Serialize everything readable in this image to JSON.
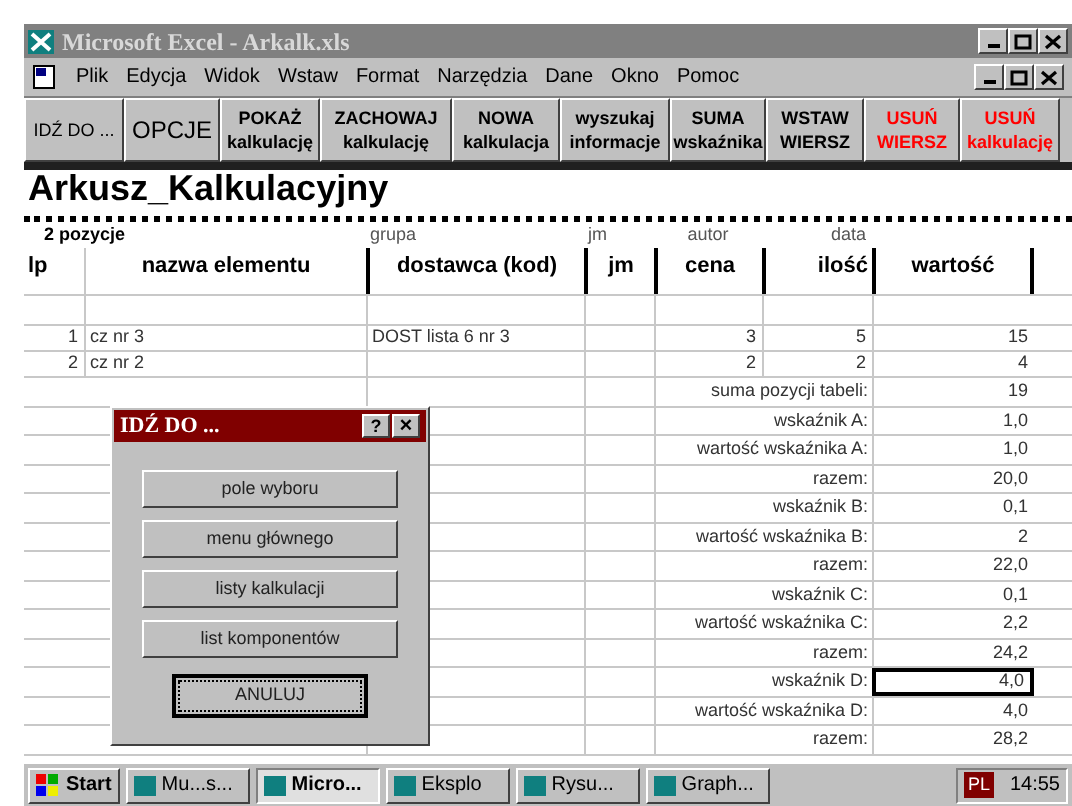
{
  "window": {
    "title": "Microsoft Excel - Arkalk.xls"
  },
  "menu": [
    "Plik",
    "Edycja",
    "Widok",
    "Wstaw",
    "Format",
    "Narzędzia",
    "Dane",
    "Okno",
    "Pomoc"
  ],
  "toolbar": [
    {
      "lines": [
        "IDŹ DO ..."
      ],
      "color": "#000000"
    },
    {
      "lines": [
        "OPCJE"
      ],
      "color": "#000000"
    },
    {
      "lines": [
        "POKAŻ",
        "kalkulację"
      ],
      "color": "#000000"
    },
    {
      "lines": [
        "ZACHOWAJ",
        "kalkulację"
      ],
      "color": "#000000"
    },
    {
      "lines": [
        "NOWA",
        "kalkulacja"
      ],
      "color": "#000000"
    },
    {
      "lines": [
        "wyszukaj",
        "informacje"
      ],
      "color": "#000000"
    },
    {
      "lines": [
        "SUMA",
        "wskaźnika"
      ],
      "color": "#000000"
    },
    {
      "lines": [
        "WSTAW",
        "WIERSZ"
      ],
      "color": "#000000"
    },
    {
      "lines": [
        "USUŃ",
        "WIERSZ"
      ],
      "color": "#ff0000"
    },
    {
      "lines": [
        "USUŃ",
        "kalkulację"
      ],
      "color": "#ff0000"
    }
  ],
  "sheet": {
    "title": "Arkusz_Kalkulacyjny",
    "info_row": [
      "2 pozycje",
      "grupa",
      "jm",
      "autor",
      "data"
    ],
    "columns": [
      "lp",
      "nazwa elementu",
      "dostawca (kod)",
      "jm",
      "cena",
      "ilość",
      "wartość"
    ],
    "rows": [
      [
        "1",
        "cz nr 3",
        "DOST lista 6 nr 3",
        "",
        "3",
        "5",
        "15"
      ],
      [
        "2",
        "cz nr 2",
        "",
        "",
        "2",
        "2",
        "4"
      ]
    ],
    "summary": [
      {
        "label": "suma pozycji tabeli:",
        "value": "19",
        "selected": false
      },
      {
        "label": "wskaźnik A:",
        "value": "1,0",
        "selected": false
      },
      {
        "label": "wartość wskaźnika A:",
        "value": "1,0",
        "selected": false
      },
      {
        "label": "razem:",
        "value": "20,0",
        "selected": false
      },
      {
        "label": "wskaźnik B:",
        "value": "0,1",
        "selected": false
      },
      {
        "label": "wartość wskaźnika B:",
        "value": "2",
        "selected": false
      },
      {
        "label": "razem:",
        "value": "22,0",
        "selected": false
      },
      {
        "label": "wskaźnik C:",
        "value": "0,1",
        "selected": false
      },
      {
        "label": "wartość wskaźnika C:",
        "value": "2,2",
        "selected": false
      },
      {
        "label": "razem:",
        "value": "24,2",
        "selected": false
      },
      {
        "label": "wskaźnik D:",
        "value": "4,0",
        "selected": true
      },
      {
        "label": "wartość wskaźnika D:",
        "value": "4,0",
        "selected": false
      },
      {
        "label": "razem:",
        "value": "28,2",
        "selected": false
      }
    ]
  },
  "dialog": {
    "title": "IDŹ DO ...",
    "help": "?",
    "close": "×",
    "buttons": [
      {
        "label": "pole wyboru",
        "focused": false
      },
      {
        "label": "menu głównego",
        "focused": false
      },
      {
        "label": "listy kalkulacji",
        "focused": false
      },
      {
        "label": "list komponentów",
        "focused": false
      }
    ],
    "cancel": {
      "label": "ANULUJ",
      "focused": true
    }
  },
  "taskbar": {
    "start": "Start",
    "items": [
      {
        "label": "Mu...s...",
        "selected": false
      },
      {
        "label": "Micro...",
        "selected": true
      },
      {
        "label": "Eksplo",
        "selected": false
      },
      {
        "label": "Rysu...",
        "selected": false
      },
      {
        "label": "Graph...",
        "selected": false
      }
    ],
    "language": "PL",
    "time": "14:55"
  }
}
